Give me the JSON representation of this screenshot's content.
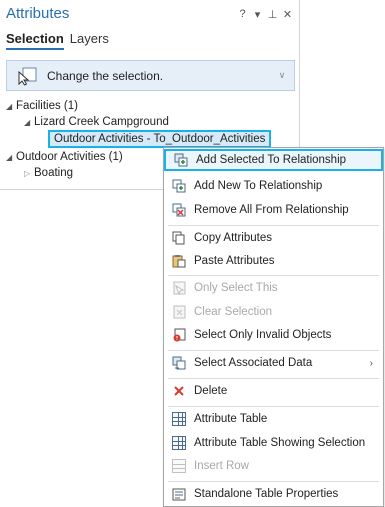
{
  "pane": {
    "title": "Attributes",
    "controls": [
      "?",
      "▾",
      "⊥",
      "✕"
    ],
    "tabs": [
      {
        "label": "Selection",
        "active": true
      },
      {
        "label": "Layers",
        "active": false
      }
    ],
    "selection_prompt": "Change the selection.",
    "tree": [
      {
        "label": "Facilities (1)"
      },
      {
        "label": "Lizard Creek Campground"
      },
      {
        "label": "Outdoor Activities - To_Outdoor_Activities"
      },
      {
        "label": "Outdoor Activities (1)"
      },
      {
        "label": "Boating"
      }
    ]
  },
  "context_menu": {
    "items": [
      {
        "label": "Add Selected To Relationship",
        "icon": "add-selected-relationship-icon",
        "disabled": false
      },
      {
        "label": "Add New To Relationship",
        "icon": "add-new-relationship-icon",
        "disabled": false
      },
      {
        "label": "Remove All From Relationship",
        "icon": "remove-relationship-icon",
        "disabled": false
      },
      {
        "label": "Copy Attributes",
        "icon": "copy-icon",
        "disabled": false
      },
      {
        "label": "Paste Attributes",
        "icon": "paste-icon",
        "disabled": false
      },
      {
        "label": "Only Select This",
        "icon": "select-this-icon",
        "disabled": true
      },
      {
        "label": "Clear Selection",
        "icon": "clear-selection-icon",
        "disabled": true
      },
      {
        "label": "Select Only Invalid Objects",
        "icon": "invalid-objects-icon",
        "disabled": false
      },
      {
        "label": "Select Associated Data",
        "icon": "associated-data-icon",
        "disabled": false
      },
      {
        "label": "Delete",
        "icon": "delete-icon",
        "disabled": false
      },
      {
        "label": "Attribute Table",
        "icon": "table-icon",
        "disabled": false
      },
      {
        "label": "Attribute Table Showing Selection",
        "icon": "table-selection-icon",
        "disabled": false
      },
      {
        "label": "Insert Row",
        "icon": "insert-row-icon",
        "disabled": true
      },
      {
        "label": "Standalone Table Properties",
        "icon": "properties-icon",
        "disabled": false
      }
    ],
    "submenu_arrow": "›"
  },
  "colors": {
    "accent": "#2a6fb3",
    "highlight_border": "#1ab1e6",
    "selection_bg": "#e6eff8",
    "delete_red": "#d83b2e"
  }
}
